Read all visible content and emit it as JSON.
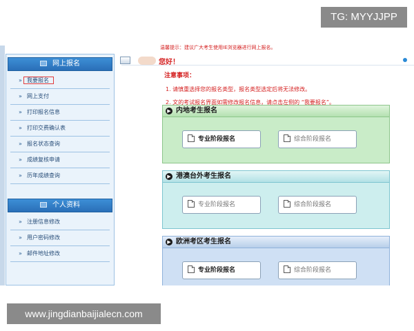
{
  "watermarks": {
    "top": "TG: MYYJJPP",
    "bottom": "www.jingdianbaijialecn.com"
  },
  "header": {
    "tip": "温馨提示：建议广大考生使用IE浏览器进行网上报名。",
    "greeting": "您好！"
  },
  "sidebar": {
    "section1": {
      "title": "网上报名",
      "items": [
        {
          "label": "我要报名"
        },
        {
          "label": "网上支付"
        },
        {
          "label": "打印报名信息"
        },
        {
          "label": "打印交费确认表"
        },
        {
          "label": "报名状态查询"
        },
        {
          "label": "成绩复核申请"
        },
        {
          "label": "历年成绩查询"
        }
      ]
    },
    "section2": {
      "title": "个人资料",
      "items": [
        {
          "label": "注册信息修改"
        },
        {
          "label": "用户密码修改"
        },
        {
          "label": "邮件地址修改"
        }
      ]
    }
  },
  "notice": {
    "title": "注意事项：",
    "line1": "1. 请慎重选择您的报名类型，报名类型选定后将无法修改。",
    "line2": "2. 文的考试报名界面如需修改报名信息，请点击左侧的 “我要报名”。"
  },
  "registration": [
    {
      "title": "内地考生报名",
      "btn1": "专业阶段报名",
      "btn2": "综合阶段报名"
    },
    {
      "title": "港澳台外考生报名",
      "btn1": "专业阶段报名",
      "btn2": "综合阶段报名"
    },
    {
      "title": "欧洲考区考生报名",
      "btn1": "专业阶段报名",
      "btn2": "综合阶段报名"
    }
  ],
  "colors": {
    "accent": "#2a6fb8",
    "alert": "#d41f1f",
    "green": "#c9ecc8",
    "cyan": "#cdeeee",
    "blue": "#cfe0f4"
  }
}
